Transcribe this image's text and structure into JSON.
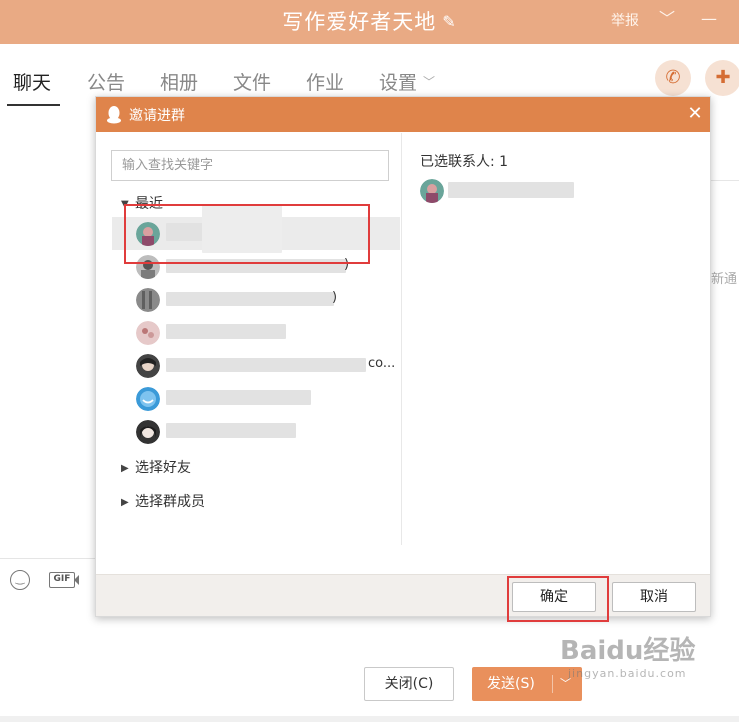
{
  "window": {
    "title": "写作爱好者天地",
    "report_label": "举报",
    "edit_icon": "pencil-icon",
    "colors": {
      "titlebar": "#e9aa84",
      "accent": "#df844b"
    }
  },
  "tabs": [
    {
      "label": "聊天",
      "active": true
    },
    {
      "label": "公告",
      "active": false
    },
    {
      "label": "相册",
      "active": false
    },
    {
      "label": "文件",
      "active": false
    },
    {
      "label": "作业",
      "active": false
    },
    {
      "label": "设置",
      "active": false
    }
  ],
  "background": {
    "right_partial_text": "新通",
    "close_button_label": "关闭(C)",
    "send_button_label": "发送(S)",
    "gif_label": "GIF"
  },
  "dialog": {
    "title": "邀请进群",
    "search_placeholder": "输入查找关键字",
    "groups": {
      "recent": "最近",
      "friends": "选择好友",
      "members": "选择群成员"
    },
    "recent_contacts": [
      {
        "tail": "",
        "highlighted": true
      },
      {
        "tail": ")",
        "highlighted": false
      },
      {
        "tail": ")",
        "highlighted": false
      },
      {
        "tail": "",
        "highlighted": false
      },
      {
        "tail": "co...",
        "highlighted": false
      },
      {
        "tail": "",
        "highlighted": false
      },
      {
        "tail": "",
        "highlighted": false
      }
    ],
    "selected_label": "已选联系人: 1",
    "confirm_label": "确定",
    "cancel_label": "取消"
  },
  "watermark": {
    "main": "Baidu经验",
    "sub": "jingyan.baidu.com"
  }
}
